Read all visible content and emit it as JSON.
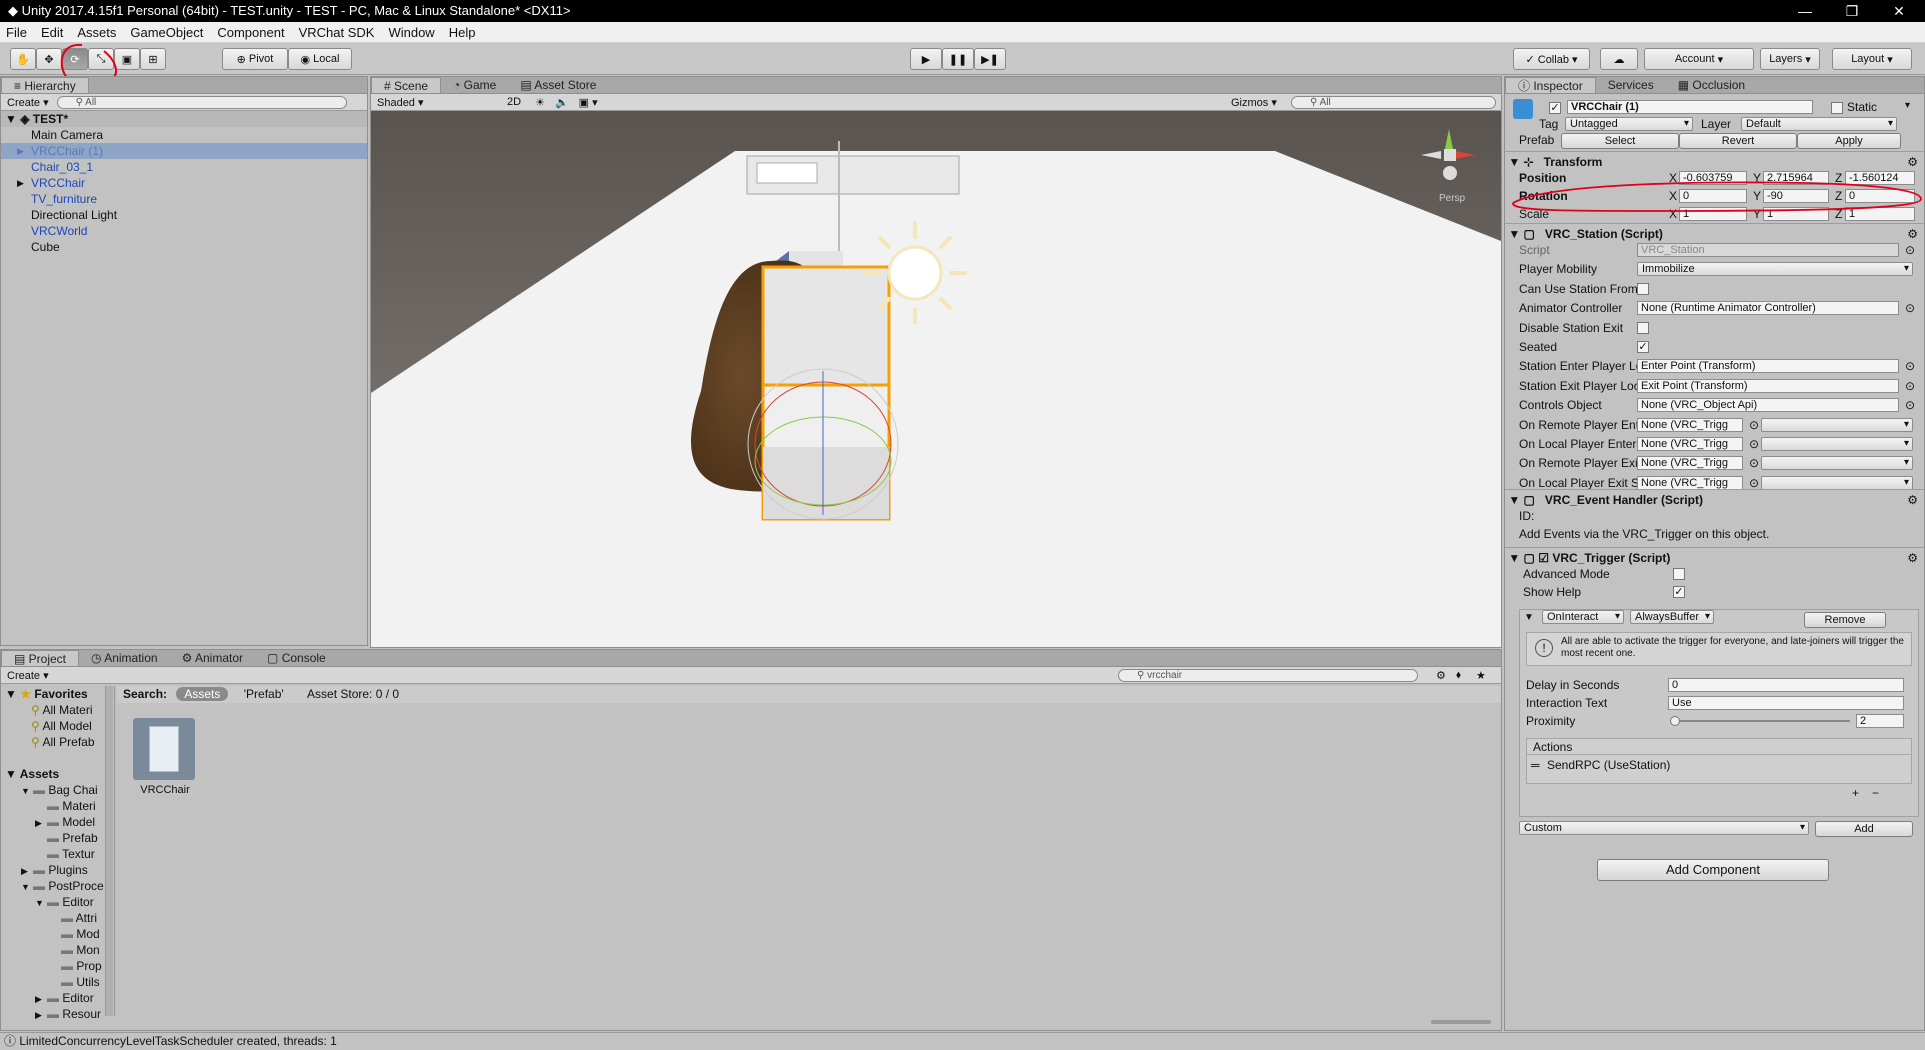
{
  "window": {
    "title": "Unity 2017.4.15f1 Personal (64bit) - TEST.unity - TEST - PC, Mac & Linux Standalone* <DX11>",
    "min": "—",
    "max": "❐",
    "close": "✕"
  },
  "menu": [
    "File",
    "Edit",
    "Assets",
    "GameObject",
    "Component",
    "VRChat SDK",
    "Window",
    "Help"
  ],
  "toolbar": {
    "pivot": "Pivot",
    "local": "Local",
    "collab": "Collab ▾",
    "account": "Account",
    "layers": "Layers",
    "layout": "Layout"
  },
  "hierarchy": {
    "tab": "Hierarchy",
    "create": "Create ▾",
    "search": "All",
    "scene": "TEST*",
    "items": [
      {
        "label": "Main Camera",
        "blue": false,
        "selected": false,
        "arrow": false
      },
      {
        "label": "VRCChair (1)",
        "blue": true,
        "selected": true,
        "arrow": true
      },
      {
        "label": "Chair_03_1",
        "blue": true,
        "selected": false,
        "arrow": false
      },
      {
        "label": "VRCChair",
        "blue": true,
        "selected": false,
        "arrow": true
      },
      {
        "label": "TV_furniture",
        "blue": true,
        "selected": false,
        "arrow": false
      },
      {
        "label": "Directional Light",
        "blue": false,
        "selected": false,
        "arrow": false
      },
      {
        "label": "VRCWorld",
        "blue": true,
        "selected": false,
        "arrow": false
      },
      {
        "label": "Cube",
        "blue": false,
        "selected": false,
        "arrow": false
      }
    ]
  },
  "scene": {
    "tabs": [
      "Scene",
      "Game",
      "Asset Store"
    ],
    "shading": "Shaded",
    "mode2d": "2D",
    "gizmos": "Gizmos ▾",
    "search": "All",
    "persp": "Persp"
  },
  "project": {
    "tabs": [
      "Project",
      "Animation",
      "Animator",
      "Console"
    ],
    "create": "Create ▾",
    "search_value": "vrcchair",
    "search_label": "Search:",
    "scope_assets": "Assets",
    "scope_prefab": "'Prefab'",
    "asset_store": "Asset Store: 0 / 0",
    "favorites_label": "Favorites",
    "favorites": [
      "All Materi",
      "All Model",
      "All Prefab"
    ],
    "assets_label": "Assets",
    "tree": [
      {
        "label": "Bag Chai",
        "indent": 1,
        "arrow": "▼"
      },
      {
        "label": "Materi",
        "indent": 2,
        "arrow": ""
      },
      {
        "label": "Model",
        "indent": 2,
        "arrow": "▶"
      },
      {
        "label": "Prefab",
        "indent": 2,
        "arrow": ""
      },
      {
        "label": "Textur",
        "indent": 2,
        "arrow": ""
      },
      {
        "label": "Plugins",
        "indent": 1,
        "arrow": "▶"
      },
      {
        "label": "PostProce",
        "indent": 1,
        "arrow": "▼"
      },
      {
        "label": "Editor",
        "indent": 2,
        "arrow": "▼"
      },
      {
        "label": "Attri",
        "indent": 3,
        "arrow": ""
      },
      {
        "label": "Mod",
        "indent": 3,
        "arrow": ""
      },
      {
        "label": "Mon",
        "indent": 3,
        "arrow": ""
      },
      {
        "label": "Prop",
        "indent": 3,
        "arrow": ""
      },
      {
        "label": "Utils",
        "indent": 3,
        "arrow": ""
      },
      {
        "label": "Editor",
        "indent": 2,
        "arrow": "▶"
      },
      {
        "label": "Resour",
        "indent": 2,
        "arrow": "▶"
      }
    ],
    "asset_name": "VRCChair"
  },
  "inspector": {
    "tabs": [
      "Inspector",
      "Services",
      "Occlusion"
    ],
    "object_name": "VRCChair (1)",
    "static": "Static",
    "tag_label": "Tag",
    "tag": "Untagged",
    "layer_label": "Layer",
    "layer": "Default",
    "prefab_label": "Prefab",
    "prefab_select": "Select",
    "prefab_revert": "Revert",
    "prefab_apply": "Apply",
    "transform": {
      "title": "Transform",
      "position_label": "Position",
      "rotation_label": "Rotation",
      "scale_label": "Scale",
      "position": {
        "x": "-0.603759",
        "y": "2.715964",
        "z": "-1.560124"
      },
      "rotation": {
        "x": "0",
        "y": "-90",
        "z": "0"
      },
      "scale": {
        "x": "1",
        "y": "1",
        "z": "1"
      }
    },
    "station": {
      "title": "VRC_Station (Script)",
      "rows": [
        {
          "label": "Script",
          "value": "VRC_Station",
          "kind": "field-disabled"
        },
        {
          "label": "Player Mobility",
          "value": "Immobilize",
          "kind": "drop"
        },
        {
          "label": "Can Use Station From Sta",
          "value": "",
          "kind": "chk"
        },
        {
          "label": "Animator Controller",
          "value": "None (Runtime Animator Controller)",
          "kind": "field"
        },
        {
          "label": "Disable Station Exit",
          "value": "",
          "kind": "chk"
        },
        {
          "label": "Seated",
          "value": "✓",
          "kind": "chk"
        },
        {
          "label": "Station Enter Player Locat",
          "value": "Enter Point (Transform)",
          "kind": "field"
        },
        {
          "label": "Station Exit Player Locatic",
          "value": "Exit Point (Transform)",
          "kind": "field"
        },
        {
          "label": "Controls Object",
          "value": "None (VRC_Object Api)",
          "kind": "field"
        },
        {
          "label": "On Remote Player Enter S",
          "value": "None (VRC_Trigg",
          "kind": "field2"
        },
        {
          "label": "On Local Player Enter Sta",
          "value": "None (VRC_Trigg",
          "kind": "field2"
        },
        {
          "label": "On Remote Player Exit St",
          "value": "None (VRC_Trigg",
          "kind": "field2"
        },
        {
          "label": "On Local Player Exit Stati",
          "value": "None (VRC_Trigg",
          "kind": "field2"
        }
      ]
    },
    "event_handler": {
      "title": "VRC_Event Handler (Script)",
      "id_label": "ID:",
      "note": "Add Events via the VRC_Trigger on this object."
    },
    "trigger": {
      "title": "VRC_Trigger (Script)",
      "advanced": "Advanced Mode",
      "show_help": "Show Help",
      "event": "OnInteract",
      "buffer": "AlwaysBuffer",
      "remove": "Remove",
      "help": "All are able to activate the trigger for everyone, and late-joiners will trigger the most recent one.",
      "delay_label": "Delay in Seconds",
      "delay": "0",
      "interaction_label": "Interaction Text",
      "interaction": "Use",
      "proximity_label": "Proximity",
      "proximity": "2",
      "actions_label": "Actions",
      "action": "SendRPC (UseStation)",
      "plus": "+",
      "minus": "−",
      "custom": "Custom",
      "add": "Add"
    },
    "add_component": "Add Component"
  },
  "status": "LimitedConcurrencyLevelTaskScheduler created, threads: 1",
  "colors": {
    "selection_outline": "#f5a000",
    "annotation": "#e0001a",
    "panel": "#c2c2c2",
    "link_blue": "#1a48b8"
  }
}
